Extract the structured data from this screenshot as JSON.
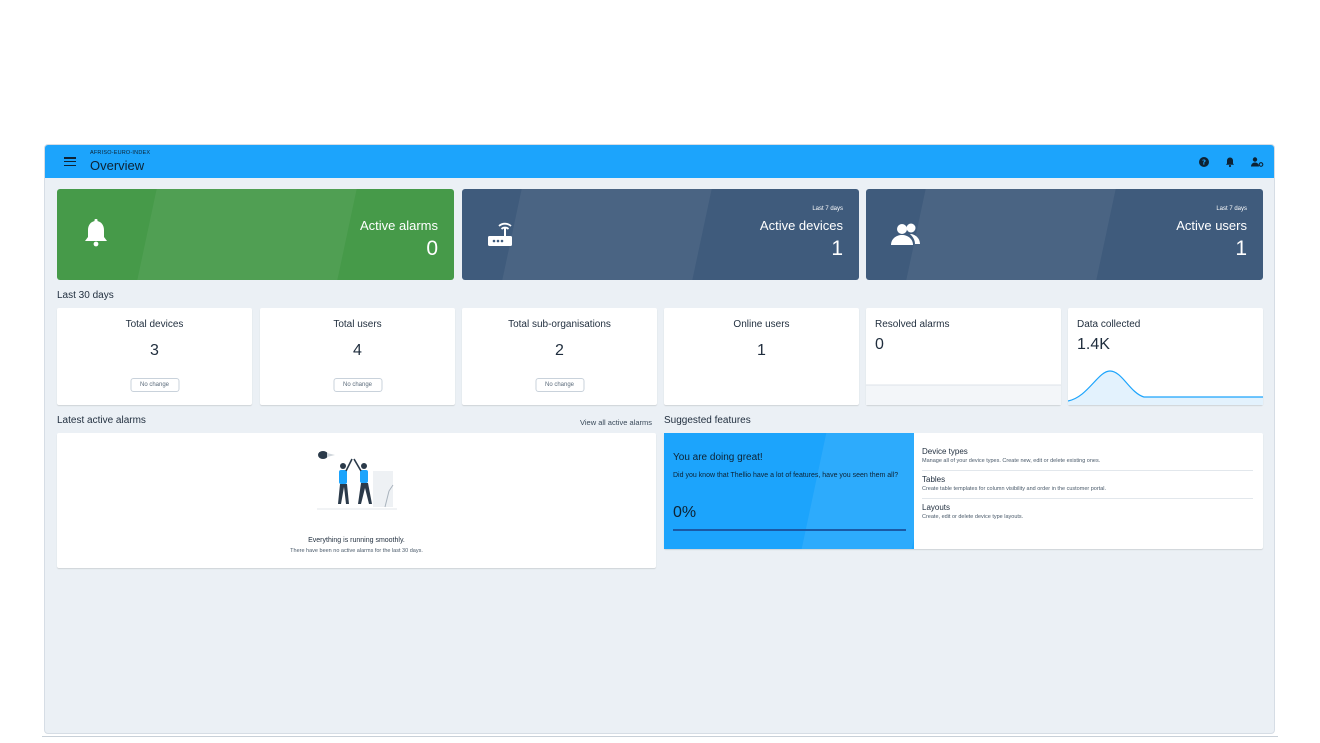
{
  "header": {
    "org": "AFRISO-EURO-INDEX",
    "title": "Overview"
  },
  "hero_cards": [
    {
      "subtitle": "",
      "label": "Active alarms",
      "value": "0",
      "color": "#469a49",
      "icon": "bell-icon"
    },
    {
      "subtitle": "Last 7 days",
      "label": "Active devices",
      "value": "1",
      "color": "#3f5b7c",
      "icon": "router-icon"
    },
    {
      "subtitle": "Last 7 days",
      "label": "Active users",
      "value": "1",
      "color": "#3f5b7c",
      "icon": "users-icon"
    }
  ],
  "period_label": "Last 30 days",
  "stats": [
    {
      "title": "Total devices",
      "value": "3",
      "chip": "No change"
    },
    {
      "title": "Total users",
      "value": "4",
      "chip": "No change"
    },
    {
      "title": "Total sub-organisations",
      "value": "2",
      "chip": "No change"
    },
    {
      "title": "Online users",
      "value": "1"
    },
    {
      "title": "Resolved alarms",
      "value": "0"
    },
    {
      "title": "Data collected",
      "value": "1.4K"
    }
  ],
  "alarms": {
    "title": "Latest active alarms",
    "view_all": "View all active alarms",
    "empty_title": "Everything is running smoothly.",
    "empty_text": "There have been no active alarms for the last 30 days."
  },
  "suggested": {
    "title": "Suggested features",
    "promo_title": "You are doing great!",
    "promo_text": "Did you know that Thellio have a lot of features, have you seen them all?",
    "progress_label": "0%",
    "progress": 0,
    "features": [
      {
        "title": "Device types",
        "desc": "Manage all of your device types. Create new, edit or delete existing ones."
      },
      {
        "title": "Tables",
        "desc": "Create table templates for column visibility and order in the customer portal."
      },
      {
        "title": "Layouts",
        "desc": "Create, edit or delete device type layouts."
      }
    ]
  },
  "colors": {
    "accent": "#1ca4fc",
    "green": "#469a49",
    "navy": "#3f5b7c",
    "background": "#ebf0f5"
  },
  "icons": [
    "menu-icon",
    "help-icon",
    "bell-icon",
    "user-settings-icon"
  ]
}
